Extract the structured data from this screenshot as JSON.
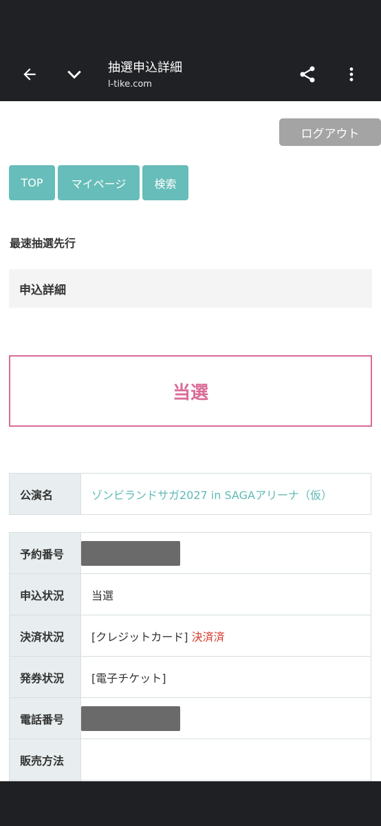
{
  "appbar": {
    "title": "抽選申込詳細",
    "url": "l-tike.com",
    "icons": [
      "back-arrow-icon",
      "chevron-down-icon",
      "share-icon",
      "more-vert-icon"
    ]
  },
  "header": {
    "logout_label": "ログアウト"
  },
  "nav": {
    "top_label": "TOP",
    "mypage_label": "マイページ",
    "search_label": "検索"
  },
  "section_title": "最速抽選先行",
  "detail_heading": "申込詳細",
  "result": {
    "label": "当選",
    "color": "#d96b97"
  },
  "performance": {
    "label": "公演名",
    "value": "ゾンビランドサガ2027 in SAGAアリーナ（仮）"
  },
  "info_rows": [
    {
      "label": "予約番号",
      "value": "",
      "masked": true
    },
    {
      "label": "申込状況",
      "value": "当選"
    },
    {
      "label": "決済状況",
      "value": "[クレジットカード]",
      "status": "決済済"
    },
    {
      "label": "発券状況",
      "value": "[電子チケット]"
    },
    {
      "label": "電話番号",
      "value": "",
      "masked": true
    },
    {
      "label": "販売方法",
      "value": ""
    }
  ],
  "colors": {
    "accent": "#66bdb9",
    "link": "#5fb9b5",
    "paid": "#d23a2a",
    "win": "#d96b97"
  }
}
